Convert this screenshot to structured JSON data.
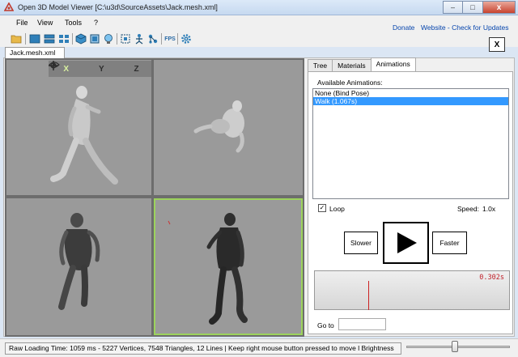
{
  "window": {
    "title": "Open 3D Model Viewer  [C:\\u3d\\SourceAssets\\Jack.mesh.xml]",
    "minimize_glyph": "–",
    "maximize_glyph": "□",
    "close_glyph": "x"
  },
  "menu": {
    "items": [
      "File",
      "View",
      "Tools",
      "?"
    ],
    "links": [
      "Donate",
      "Website - Check for Updates"
    ]
  },
  "toolbar": {
    "icons": [
      "folder-icon",
      "layout-single-icon",
      "layout-rows-icon",
      "layout-grid-icon",
      "cube-icon",
      "cube-wire-icon",
      "bulb-icon",
      "frame-icon",
      "skeleton-icon",
      "nodes-icon",
      "fps-icon",
      "gear-icon"
    ],
    "fps_label": "FPS",
    "close_tab_label": "X"
  },
  "document": {
    "tab_label": "Jack.mesh.xml"
  },
  "viewport": {
    "axes": [
      "X",
      "Y",
      "Z"
    ],
    "selected_axis": "X",
    "active_view": "bottom-right"
  },
  "panel": {
    "tabs": [
      "Tree",
      "Materials",
      "Animations"
    ],
    "active_tab": "Animations",
    "available_label": "Available Animations:",
    "animations": [
      "None (Bind Pose)",
      "Walk (1.067s)"
    ],
    "selected_animation": "Walk (1.067s)",
    "loop_label": "Loop",
    "loop_checked": "✓",
    "speed_label": "Speed:",
    "speed_value": "1.0x",
    "slower_label": "Slower",
    "faster_label": "Faster",
    "time_readout": "0.302s",
    "goto_label": "Go to",
    "goto_value": ""
  },
  "status": {
    "text": "Raw Loading Time: 1059 ms - 5227 Vertices, 7548 Triangles, 12 Lines  | Keep right mouse button pressed to move l  Brightness",
    "brightness_level": 0.47
  },
  "colors": {
    "active_view_border": "#9cd35c",
    "selection": "#3399ff",
    "time_readout": "#c0202a",
    "link": "#0645ad"
  }
}
